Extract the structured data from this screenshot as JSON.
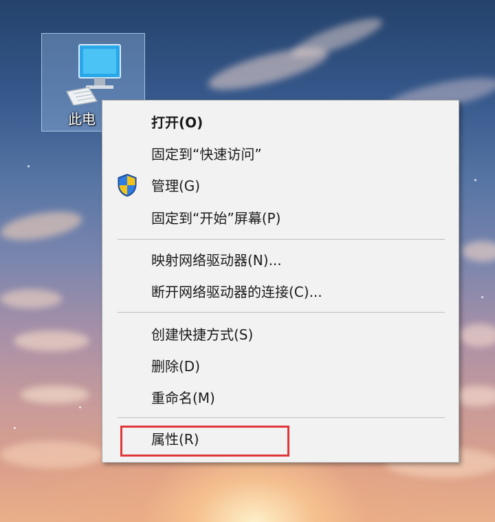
{
  "desktop": {
    "icon": {
      "name": "此电",
      "icon": "computer-icon"
    }
  },
  "context_menu": {
    "items": [
      {
        "label": "打开(O)",
        "bold": true
      },
      {
        "label": "固定到“快速访问”"
      },
      {
        "label": "管理(G)",
        "icon": "uac-shield-icon"
      },
      {
        "label": "固定到“开始”屏幕(P)"
      },
      {
        "label": "映射网络驱动器(N)..."
      },
      {
        "label": "断开网络驱动器的连接(C)..."
      },
      {
        "label": "创建快捷方式(S)"
      },
      {
        "label": "删除(D)"
      },
      {
        "label": "重命名(M)"
      },
      {
        "label": "属性(R)",
        "highlighted": true
      }
    ]
  },
  "colors": {
    "menu_background": "#f2f2f2",
    "highlight_border": "#e0363a",
    "selection_tint": "#b4d7ff"
  }
}
